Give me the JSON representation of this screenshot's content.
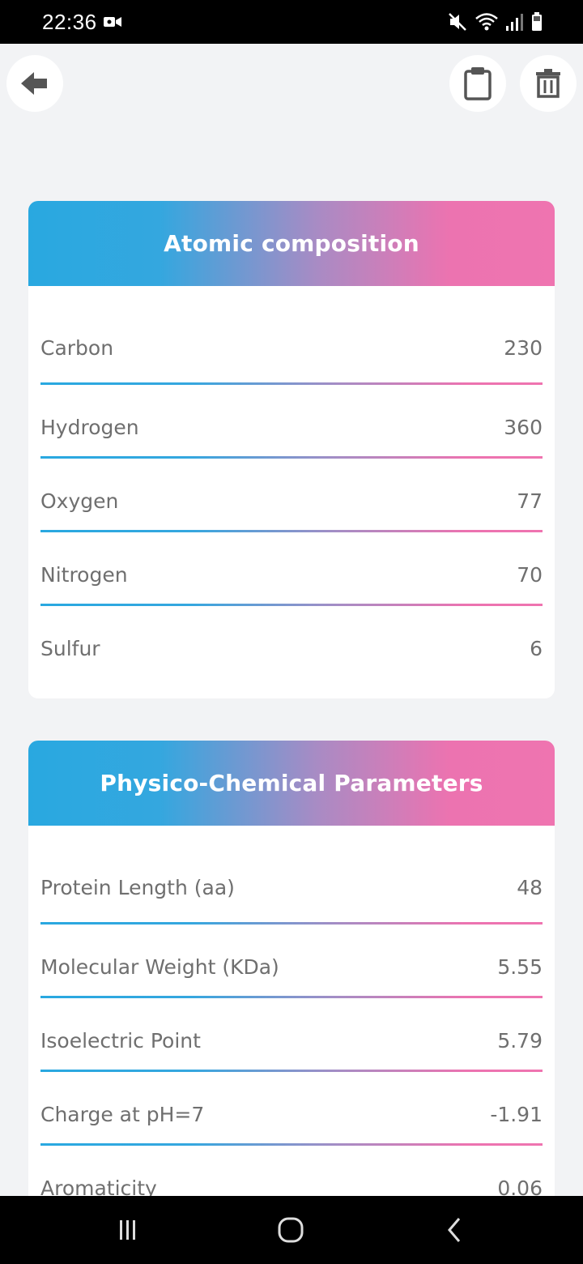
{
  "status_bar": {
    "time": "22:36"
  },
  "icons": {
    "back": "arrow-left-icon",
    "clipboard": "clipboard-icon",
    "trash": "trash-icon"
  },
  "atomic": {
    "title": "Atomic composition",
    "rows": [
      {
        "label": "Carbon",
        "value": "230"
      },
      {
        "label": "Hydrogen",
        "value": "360"
      },
      {
        "label": "Oxygen",
        "value": "77"
      },
      {
        "label": "Nitrogen",
        "value": "70"
      },
      {
        "label": "Sulfur",
        "value": "6"
      }
    ]
  },
  "physico": {
    "title": "Physico-Chemical Parameters",
    "rows": [
      {
        "label": "Protein Length (aa)",
        "value": "48"
      },
      {
        "label": "Molecular Weight (KDa)",
        "value": "5.55"
      },
      {
        "label": "Isoelectric Point",
        "value": "5.79"
      },
      {
        "label": "Charge at pH=7",
        "value": "-1.91"
      },
      {
        "label": "Aromaticity",
        "value": "0.06"
      }
    ]
  },
  "colors": {
    "gradient_start": "#29a8e0",
    "gradient_end": "#ef74b0"
  }
}
